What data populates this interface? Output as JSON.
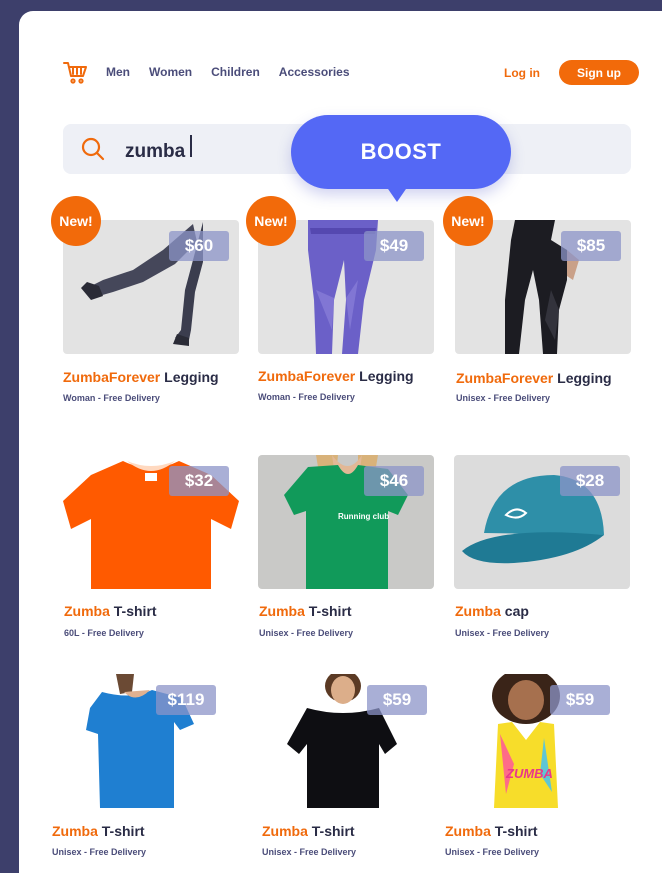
{
  "nav": {
    "links": [
      "Men",
      "Women",
      "Children",
      "Accessories"
    ],
    "login": "Log in",
    "signup": "Sign up"
  },
  "search": {
    "value": "zumba"
  },
  "boost": {
    "label": "BOOST"
  },
  "colors": {
    "accent": "#f26a0a",
    "boost": "#5468f5",
    "text": "#2a2c46"
  },
  "products": [
    {
      "brand": "ZumbaForever",
      "name": "Legging",
      "price": "$60",
      "sub": "Woman - Free Delivery",
      "badge": "New!"
    },
    {
      "brand": "ZumbaForever",
      "name": "Legging",
      "price": "$49",
      "sub": "Woman - Free Delivery",
      "badge": "New!"
    },
    {
      "brand": "ZumbaForever",
      "name": "Legging",
      "price": "$85",
      "sub": "Unisex - Free Delivery",
      "badge": "New!"
    },
    {
      "brand": "Zumba",
      "name": "T-shirt",
      "price": "$32",
      "sub": "60L - Free Delivery"
    },
    {
      "brand": "Zumba",
      "name": "T-shirt",
      "price": "$46",
      "sub": "Unisex - Free Delivery",
      "print": "Running club"
    },
    {
      "brand": "Zumba",
      "name": "cap",
      "price": "$28",
      "sub": "Unisex - Free Delivery"
    },
    {
      "brand": "Zumba",
      "name": "T-shirt",
      "price": "$119",
      "sub": "Unisex - Free Delivery"
    },
    {
      "brand": "Zumba",
      "name": "T-shirt",
      "price": "$59",
      "sub": "Unisex - Free Delivery"
    },
    {
      "brand": "Zumba",
      "name": "T-shirt",
      "price": "$59",
      "sub": "Unisex - Free Delivery",
      "print": "ZUMBA"
    }
  ]
}
